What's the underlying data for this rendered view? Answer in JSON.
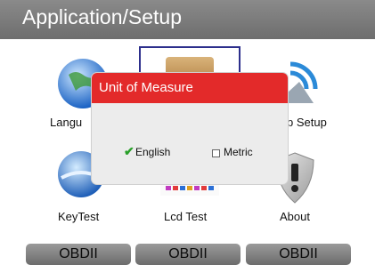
{
  "title": "Application/Setup",
  "tiles": {
    "language": "Langu",
    "setup": "p Setup",
    "keytest": "KeyTest",
    "lcdtest": "Lcd Test",
    "about": "About"
  },
  "dialog": {
    "title": "Unit of Measure",
    "options": [
      {
        "label": "English",
        "selected": true
      },
      {
        "label": "Metric",
        "selected": false
      }
    ]
  },
  "softkeys": [
    "OBDII",
    "OBDII",
    "OBDII"
  ],
  "colors": {
    "accent_red": "#e32a2a",
    "titlebar": "#7a7a7a",
    "check_green": "#2aa02a"
  }
}
